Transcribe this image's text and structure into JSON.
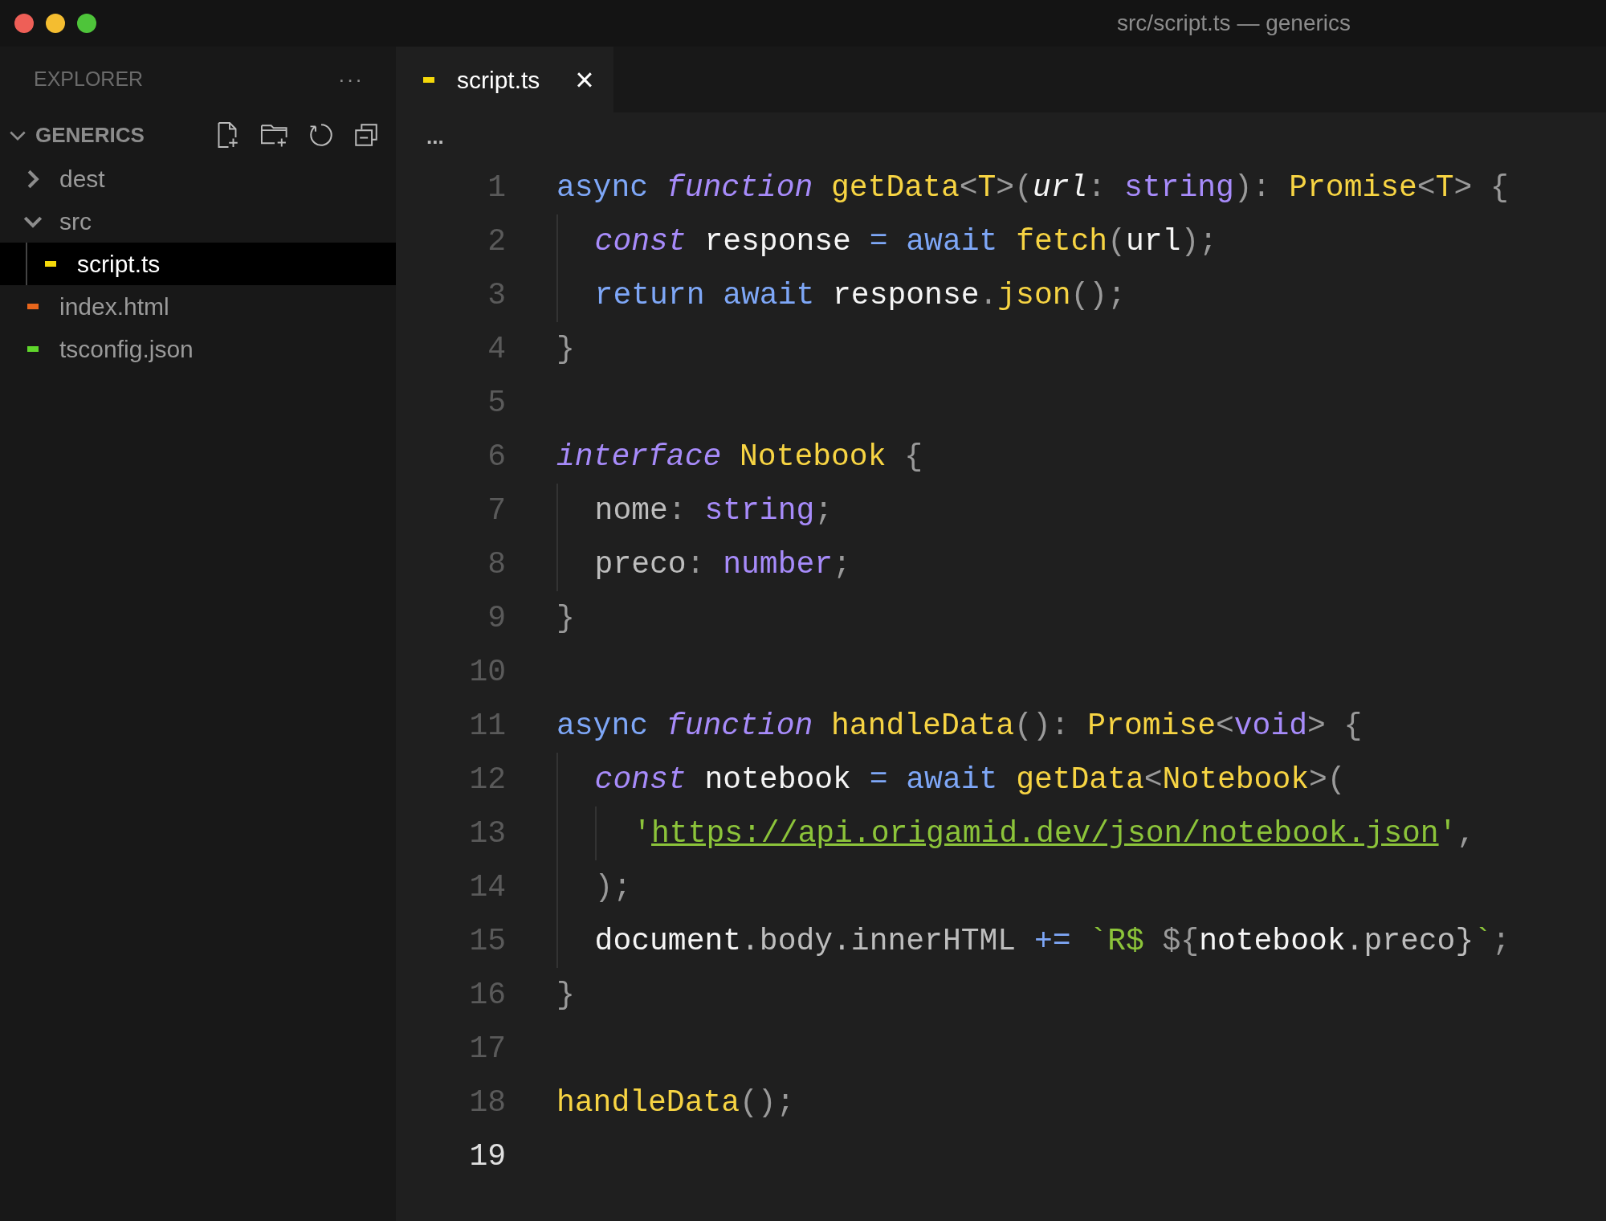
{
  "window": {
    "title": "src/script.ts — generics"
  },
  "sidebar": {
    "title": "EXPLORER",
    "more": "···",
    "section": {
      "label": "GENERICS",
      "expanded": true,
      "children": [
        {
          "label": "dest",
          "kind": "folder",
          "expanded": false,
          "selected": false
        },
        {
          "label": "src",
          "kind": "folder",
          "expanded": true,
          "selected": false,
          "children": [
            {
              "label": "script.ts",
              "kind": "file",
              "color": "#f5d90a",
              "selected": true
            }
          ]
        },
        {
          "label": "index.html",
          "kind": "file",
          "color": "#e8661c",
          "selected": false
        },
        {
          "label": "tsconfig.json",
          "kind": "file",
          "color": "#5fd62b",
          "selected": false
        }
      ]
    }
  },
  "tabs": [
    {
      "label": "script.ts",
      "color": "#f5d90a",
      "selected": true,
      "close": "×"
    }
  ],
  "breadcrumb": "...",
  "editor": {
    "lines": [
      {
        "number": "1",
        "current": false,
        "tokens": [
          {
            "text": "async ",
            "kind": "keyword"
          },
          {
            "text": "function ",
            "kind": "storage"
          },
          {
            "text": "getData",
            "kind": "function"
          },
          {
            "text": "<",
            "kind": "punct"
          },
          {
            "text": "T",
            "kind": "type"
          },
          {
            "text": ">(",
            "kind": "punct"
          },
          {
            "text": "url",
            "kind": "param"
          },
          {
            "text": ": ",
            "kind": "punct"
          },
          {
            "text": "string",
            "kind": "primitive"
          },
          {
            "text": "): ",
            "kind": "punct"
          },
          {
            "text": "Promise",
            "kind": "type"
          },
          {
            "text": "<",
            "kind": "punct"
          },
          {
            "text": "T",
            "kind": "type"
          },
          {
            "text": "> {",
            "kind": "punct"
          }
        ]
      },
      {
        "number": "2",
        "current": false,
        "tokens": [
          {
            "text": "  const",
            "kind": "storage"
          },
          {
            "text": " response ",
            "kind": "variable"
          },
          {
            "text": "= await ",
            "kind": "keyword"
          },
          {
            "text": "fetch",
            "kind": "function"
          },
          {
            "text": "(",
            "kind": "punct"
          },
          {
            "text": "url",
            "kind": "variable"
          },
          {
            "text": ");",
            "kind": "punct"
          }
        ]
      },
      {
        "number": "3",
        "current": false,
        "tokens": [
          {
            "text": "  return await",
            "kind": "keyword"
          },
          {
            "text": " response",
            "kind": "variable"
          },
          {
            "text": ".",
            "kind": "punct"
          },
          {
            "text": "json",
            "kind": "function"
          },
          {
            "text": "();",
            "kind": "punct"
          }
        ]
      },
      {
        "number": "4",
        "current": false,
        "tokens": [
          {
            "text": "}",
            "kind": "punct"
          }
        ]
      },
      {
        "number": "5",
        "current": false
      },
      {
        "number": "6",
        "current": false,
        "tokens": [
          {
            "text": "interface ",
            "kind": "storage"
          },
          {
            "text": "Notebook",
            "kind": "type"
          },
          {
            "text": " {",
            "kind": "punct"
          }
        ]
      },
      {
        "number": "7",
        "current": false,
        "tokens": [
          {
            "text": "  nome",
            "kind": "property"
          },
          {
            "text": ": ",
            "kind": "punct"
          },
          {
            "text": "string",
            "kind": "primitive"
          },
          {
            "text": ";",
            "kind": "punct"
          }
        ]
      },
      {
        "number": "8",
        "current": false,
        "tokens": [
          {
            "text": "  preco",
            "kind": "property"
          },
          {
            "text": ": ",
            "kind": "punct"
          },
          {
            "text": "number",
            "kind": "primitive"
          },
          {
            "text": ";",
            "kind": "punct"
          }
        ]
      },
      {
        "number": "9",
        "current": false,
        "tokens": [
          {
            "text": "}",
            "kind": "punct"
          }
        ]
      },
      {
        "number": "10",
        "current": false
      },
      {
        "number": "11",
        "current": false,
        "tokens": [
          {
            "text": "async ",
            "kind": "keyword"
          },
          {
            "text": "function ",
            "kind": "storage"
          },
          {
            "text": "handleData",
            "kind": "function"
          },
          {
            "text": "(): ",
            "kind": "punct"
          },
          {
            "text": "Promise",
            "kind": "type"
          },
          {
            "text": "<",
            "kind": "punct"
          },
          {
            "text": "void",
            "kind": "primitive"
          },
          {
            "text": "> {",
            "kind": "punct"
          }
        ]
      },
      {
        "number": "12",
        "current": false,
        "tokens": [
          {
            "text": "  const",
            "kind": "storage"
          },
          {
            "text": " notebook ",
            "kind": "variable"
          },
          {
            "text": "= await ",
            "kind": "keyword"
          },
          {
            "text": "getData",
            "kind": "function"
          },
          {
            "text": "<",
            "kind": "punct"
          },
          {
            "text": "Notebook",
            "kind": "type"
          },
          {
            "text": ">(",
            "kind": "punct"
          }
        ]
      },
      {
        "number": "13",
        "current": false,
        "tokens": [
          {
            "text": "    '",
            "kind": "string"
          },
          {
            "text": "https://api.origamid.dev/json/notebook.json",
            "kind": "url"
          },
          {
            "text": "'",
            "kind": "string"
          },
          {
            "text": ",",
            "kind": "punct"
          }
        ]
      },
      {
        "number": "14",
        "current": false,
        "tokens": [
          {
            "text": "  );",
            "kind": "punct"
          }
        ]
      },
      {
        "number": "15",
        "current": false,
        "tokens": [
          {
            "text": "  document",
            "kind": "variable"
          },
          {
            "text": ".body.innerHTML ",
            "kind": "property"
          },
          {
            "text": "+= ",
            "kind": "keyword"
          },
          {
            "text": "`R$ ",
            "kind": "string"
          },
          {
            "text": "${",
            "kind": "punct"
          },
          {
            "text": "notebook",
            "kind": "variable"
          },
          {
            "text": ".preco}",
            "kind": "property"
          },
          {
            "text": "`",
            "kind": "string"
          },
          {
            "text": ";",
            "kind": "punct"
          }
        ]
      },
      {
        "number": "16",
        "current": false,
        "tokens": [
          {
            "text": "}",
            "kind": "punct"
          }
        ]
      },
      {
        "number": "17",
        "current": false
      },
      {
        "number": "18",
        "current": false,
        "tokens": [
          {
            "text": "handleData",
            "kind": "function"
          },
          {
            "text": "();",
            "kind": "punct"
          }
        ]
      },
      {
        "number": "19",
        "current": true
      }
    ]
  }
}
